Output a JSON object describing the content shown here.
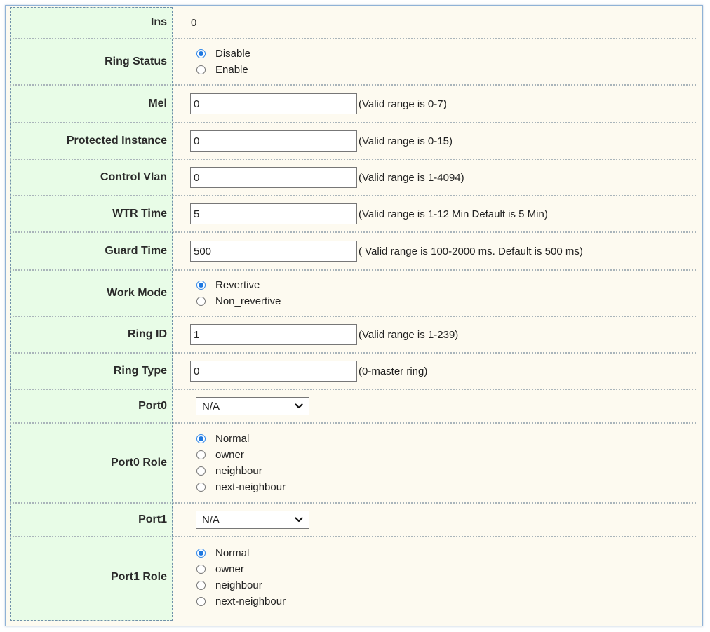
{
  "fields": {
    "ins": {
      "label": "Ins",
      "value": "0"
    },
    "ring_status": {
      "label": "Ring Status",
      "options": [
        "Disable",
        "Enable"
      ],
      "selected": "Disable"
    },
    "mel": {
      "label": "Mel",
      "value": "0",
      "hint": "(Valid range is 0-7)"
    },
    "protected_instance": {
      "label": "Protected Instance",
      "value": "0",
      "hint": "(Valid range is 0-15)"
    },
    "control_vlan": {
      "label": "Control Vlan",
      "value": "0",
      "hint": "(Valid range is 1-4094)"
    },
    "wtr_time": {
      "label": "WTR Time",
      "value": "5",
      "hint": "(Valid range is 1-12 Min Default is 5 Min)"
    },
    "guard_time": {
      "label": "Guard Time",
      "value": "500",
      "hint": "( Valid range is 100-2000 ms. Default is 500 ms)"
    },
    "work_mode": {
      "label": "Work Mode",
      "options": [
        "Revertive",
        "Non_revertive"
      ],
      "selected": "Revertive"
    },
    "ring_id": {
      "label": "Ring ID",
      "value": "1",
      "hint": "(Valid range is 1-239)"
    },
    "ring_type": {
      "label": "Ring Type",
      "value": "0",
      "hint": "(0-master ring)"
    },
    "port0": {
      "label": "Port0",
      "selected": "N/A"
    },
    "port0_role": {
      "label": "Port0 Role",
      "options": [
        "Normal",
        "owner",
        "neighbour",
        "next-neighbour"
      ],
      "selected": "Normal"
    },
    "port1": {
      "label": "Port1",
      "selected": "N/A"
    },
    "port1_role": {
      "label": "Port1 Role",
      "options": [
        "Normal",
        "owner",
        "neighbour",
        "next-neighbour"
      ],
      "selected": "Normal"
    }
  },
  "colors": {
    "label_bg": "#e8fce7",
    "value_bg": "#fdfaf0",
    "radio_accent": "#1e78e0",
    "frame_border": "#8fb2d6"
  },
  "icons": {
    "dropdown": "chevron-down-icon"
  }
}
